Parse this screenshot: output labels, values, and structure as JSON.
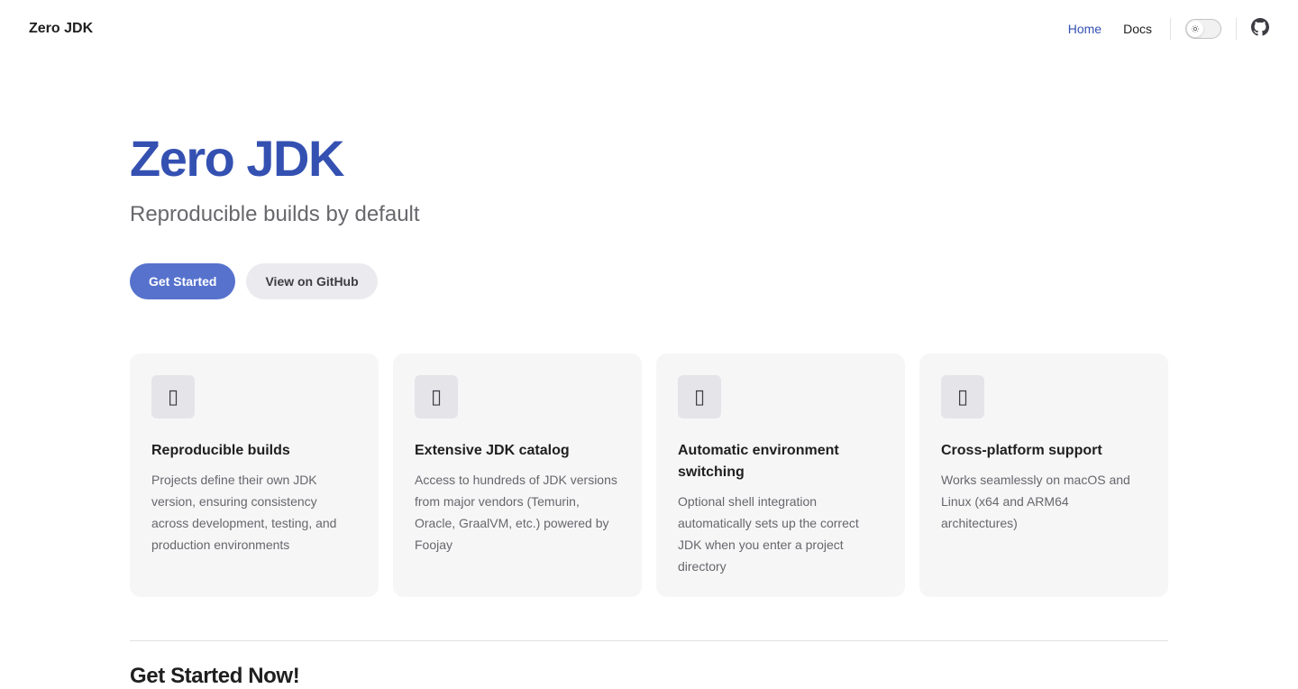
{
  "nav": {
    "brand": "Zero JDK",
    "links": [
      {
        "label": "Home",
        "active": true
      },
      {
        "label": "Docs",
        "active": false
      }
    ],
    "theme_toggle_icon": "sun-icon",
    "github_icon": "github-icon"
  },
  "hero": {
    "title": "Zero JDK",
    "tagline": "Reproducible builds by default",
    "primary_action": "Get Started",
    "secondary_action": "View on GitHub"
  },
  "features": [
    {
      "icon": "placeholder-glyph",
      "icon_char": "▯",
      "title": "Reproducible builds",
      "desc": "Projects define their own JDK version, ensuring consistency across development, testing, and production environments"
    },
    {
      "icon": "placeholder-glyph",
      "icon_char": "▯",
      "title": "Extensive JDK catalog",
      "desc": "Access to hundreds of JDK versions from major vendors (Temurin, Oracle, GraalVM, etc.) powered by Foojay"
    },
    {
      "icon": "placeholder-glyph",
      "icon_char": "▯",
      "title": "Automatic environment switching",
      "desc": "Optional shell integration automatically sets up the correct JDK when you enter a project directory"
    },
    {
      "icon": "placeholder-glyph",
      "icon_char": "▯",
      "title": "Cross-platform support",
      "desc": "Works seamlessly on macOS and Linux (x64 and ARM64 architectures)"
    }
  ],
  "section": {
    "title": "Get Started Now!"
  },
  "colors": {
    "brand": "#3451b2",
    "button_brand": "#5672cd",
    "button_alt": "#ebebef",
    "card_bg": "#f6f6f7"
  }
}
